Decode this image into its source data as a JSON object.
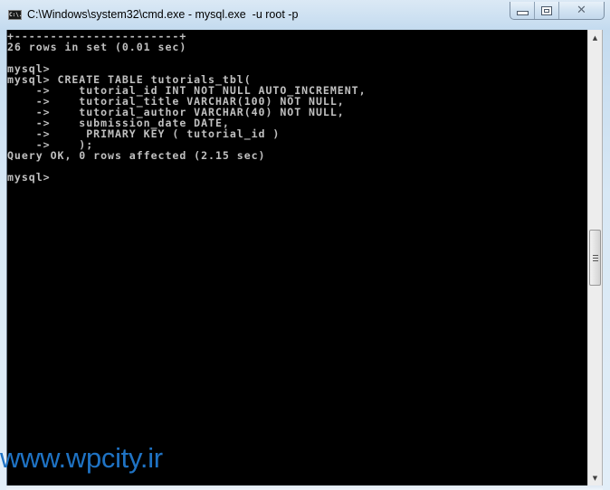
{
  "window": {
    "title": "C:\\Windows\\system32\\cmd.exe - mysql.exe  -u root -p",
    "icon_label": "C:\\.",
    "icon": "cmd-icon",
    "buttons": {
      "minimize": "minimize-icon",
      "maximize": "maximize-icon",
      "close": "close-icon",
      "close_glyph": "✕"
    }
  },
  "console": {
    "background": "#000000",
    "foreground": "#c0c0c0",
    "lines": [
      "+-----------------------+",
      "26 rows in set (0.01 sec)",
      "",
      "mysql>",
      "mysql> CREATE TABLE tutorials_tbl(",
      "    ->    tutorial_id INT NOT NULL AUTO_INCREMENT,",
      "    ->    tutorial_title VARCHAR(100) NOT NULL,",
      "    ->    tutorial_author VARCHAR(40) NOT NULL,",
      "    ->    submission_date DATE,",
      "    ->     PRIMARY KEY ( tutorial_id )",
      "    ->    );",
      "Query OK, 0 rows affected (2.15 sec)",
      "",
      "mysql>"
    ]
  },
  "scrollbar": {
    "up_arrow": "▲",
    "down_arrow": "▼",
    "position_fraction": 0.5
  },
  "watermark": {
    "text": "www.wpcity.ir",
    "color": "#1f73c4"
  }
}
